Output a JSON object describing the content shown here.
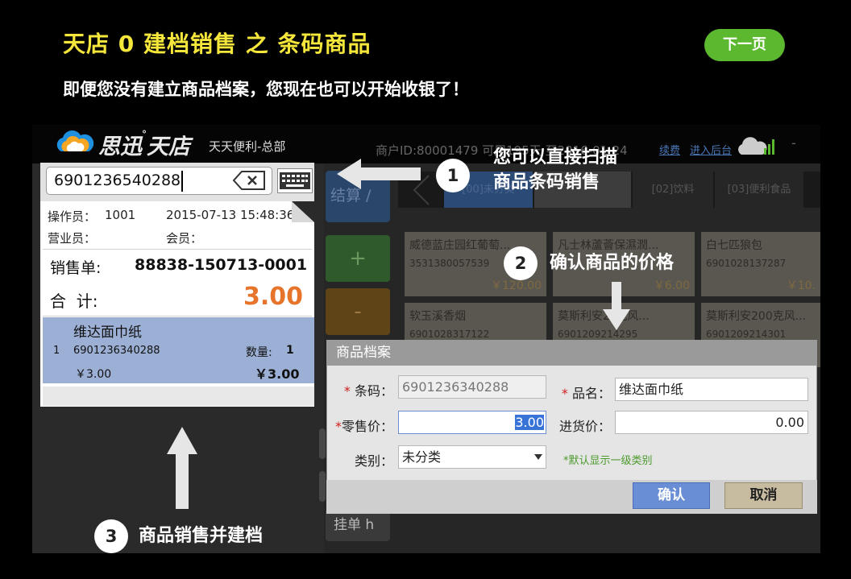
{
  "slide": {
    "title": "天店 0 建档销售 之 条码商品",
    "subtitle": "即便您没有建立商品档案，您现在也可以开始收银了！",
    "next_label": "下一页"
  },
  "app": {
    "brand": "思迅",
    "brand2": "天店",
    "store": "天天便利-总部",
    "merchant": "商户ID:80001479 可用195天 至2016-01-24",
    "link_renew": "续费",
    "link_admin": "进入后台",
    "dash": "-"
  },
  "search": {
    "value": "6901236540288"
  },
  "receipt": {
    "operator_label": "操作员：",
    "operator": "1001",
    "datetime": "2015-07-13 15:48:36",
    "clerk_label": "营业员：",
    "member_label": "会员：",
    "order_label": "销售单:",
    "order_no": "88838-150713-0001",
    "total_label": "合  计:",
    "total": "3.00",
    "item": {
      "name": "维达面巾纸",
      "index": "1",
      "code": "6901236340288",
      "qty_label": "数量:",
      "qty": "1",
      "unit_price": "￥3.00",
      "subtotal": "￥3.00"
    }
  },
  "pos": {
    "checkout_label": "结算 /",
    "plus_label": "+",
    "minus_label": "-",
    "hold_label": "挂单 h",
    "tabs": [
      "[00]未分类",
      "",
      "[02]饮料",
      "[03]便利食品"
    ],
    "products": [
      {
        "name": "威德蓝庄园红葡萄...",
        "code": "3531380057539",
        "price": "￥120.00"
      },
      {
        "name": "凡士林蘆薈保濕潤...",
        "code": "",
        "price": "￥6.00"
      },
      {
        "name": "白七匹狼包",
        "code": "6901028137287",
        "price": "￥10."
      },
      {
        "name": "软玉溪香烟",
        "code": "6901028317122",
        "price": ""
      },
      {
        "name": "莫斯利安2?克风...",
        "code": "6901209214295",
        "price": ""
      },
      {
        "name": "莫斯利安200克风...",
        "code": "6901209214301",
        "price": ""
      }
    ]
  },
  "dialog": {
    "title": "商品档案",
    "barcode_label": "条码：",
    "barcode": "6901236340288",
    "name_label": "品名：",
    "name": "维达面巾纸",
    "retail_label": "零售价：",
    "retail": "3.00",
    "purchase_label": "进货价：",
    "purchase": "0.00",
    "category_label": "类别：",
    "category": "未分类",
    "hint": "*默认显示一级类别",
    "confirm": "确认",
    "cancel": "取消"
  },
  "steps": [
    {
      "num": "1",
      "line1": "您可以直接扫描",
      "line2": "商品条码销售"
    },
    {
      "num": "2",
      "text": "确认商品的价格"
    },
    {
      "num": "3",
      "text": "商品销售并建档"
    }
  ]
}
